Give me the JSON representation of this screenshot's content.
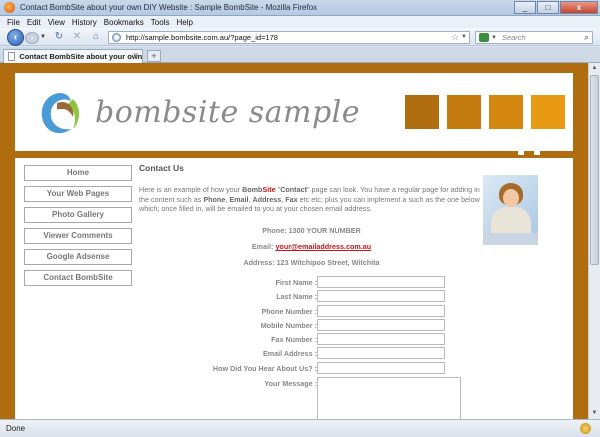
{
  "window": {
    "title": "Contact BombSite about your own DIY Website : Sample BombSite - Mozilla Firefox",
    "min_label": "_",
    "max_label": "□",
    "close_label": "x"
  },
  "menu": {
    "items": [
      "File",
      "Edit",
      "View",
      "History",
      "Bookmarks",
      "Tools",
      "Help"
    ]
  },
  "navbar": {
    "url": "http://sample.bombsite.com.au/?page_id=178",
    "search_placeholder": "Search"
  },
  "tab": {
    "label": "Contact BombSite about your own DI..."
  },
  "site": {
    "logo_text": "bombsite sample",
    "accent_colors": [
      "#b06d10",
      "#c2790e",
      "#d4870e",
      "#e89a12"
    ],
    "nav": [
      "Home",
      "Your Web Pages",
      "Photo Gallery",
      "Viewer Comments",
      "Google Adsense",
      "Contact BombSite"
    ]
  },
  "contact": {
    "title": "Contact Us",
    "intro_a": "Here is an example of how your ",
    "intro_bomb": "Bomb",
    "intro_site": "Site",
    "intro_b": " \"",
    "intro_contact": "Contact",
    "intro_c": "\" page can look. You have a regular page for adding in the content such as ",
    "intro_phone": "Phone",
    "intro_d": ", ",
    "intro_email": "Email",
    "intro_e": ", ",
    "intro_address": "Address",
    "intro_f": ", ",
    "intro_fax": "Fax",
    "intro_g": " etc etc; plus you can implement a such as the one below which; once filled in, will be emailed to you at your chosen email address.",
    "phone": "Phone: 1300 YOUR NUMBER",
    "email_label": "Email: ",
    "email": "your@emailaddress.com.au",
    "address": "Address: 123 Witchipoo Street, Witchita"
  },
  "form": {
    "first_name": "First Name :",
    "last_name": "Last Name :",
    "phone": "Phone Number :",
    "mobile": "Mobile Number :",
    "fax": "Fax Number :",
    "email": "Email Address :",
    "hear": "How Did You Hear About Us? :",
    "message": "Your Message :"
  },
  "status": {
    "text": "Done"
  }
}
